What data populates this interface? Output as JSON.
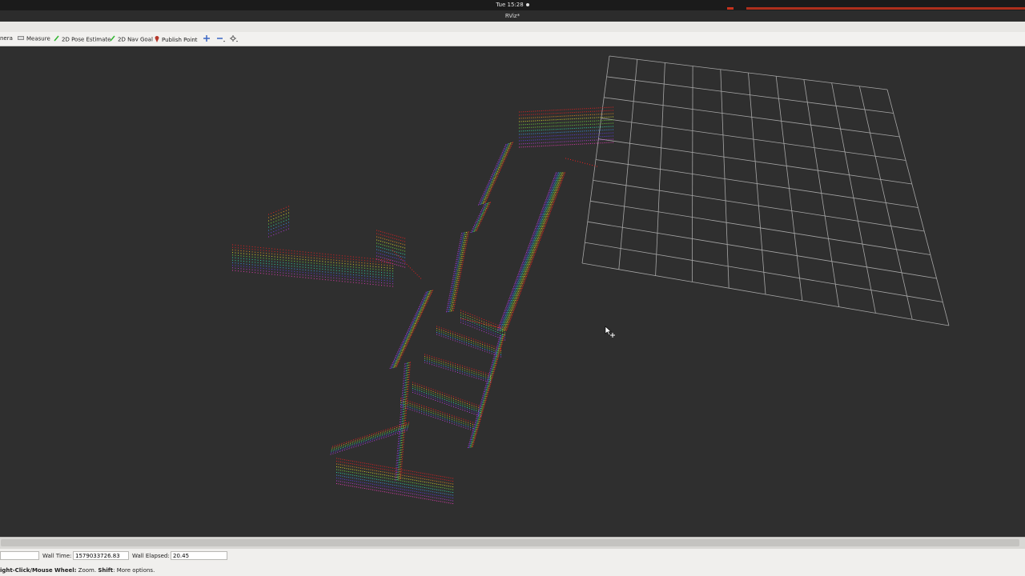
{
  "system": {
    "clock": "Tue 15:28"
  },
  "window": {
    "title": "RViz*"
  },
  "toolbar": {
    "camera_label": "nera",
    "measure_label": "Measure",
    "pose_estimate_label": "2D Pose Estimate",
    "nav_goal_label": "2D Nav Goal",
    "publish_point_label": "Publish Point"
  },
  "timebar": {
    "wall_time_label": "Wall Time:",
    "wall_time_value": "1579033726.83",
    "wall_elapsed_label": "Wall Elapsed:",
    "wall_elapsed_value": "20.45"
  },
  "status": {
    "bold1": "ight-Click/Mouse Wheel:",
    "text1": " Zoom. ",
    "bold2": "Shift",
    "text2": ": More options."
  },
  "colors": {
    "viewport_bg": "#2f2f2f",
    "grid": "#a6a6a6",
    "accent_red": "#c8321c"
  },
  "icons": {
    "measure": "ruler-icon",
    "pose_estimate": "green-arrow-icon",
    "nav_goal": "green-arrow-icon",
    "publish_point": "map-pin-icon",
    "move_camera": "move-icon",
    "zoom_out": "minus-icon",
    "focus": "focus-icon",
    "cursor": "move-cursor-icon"
  }
}
